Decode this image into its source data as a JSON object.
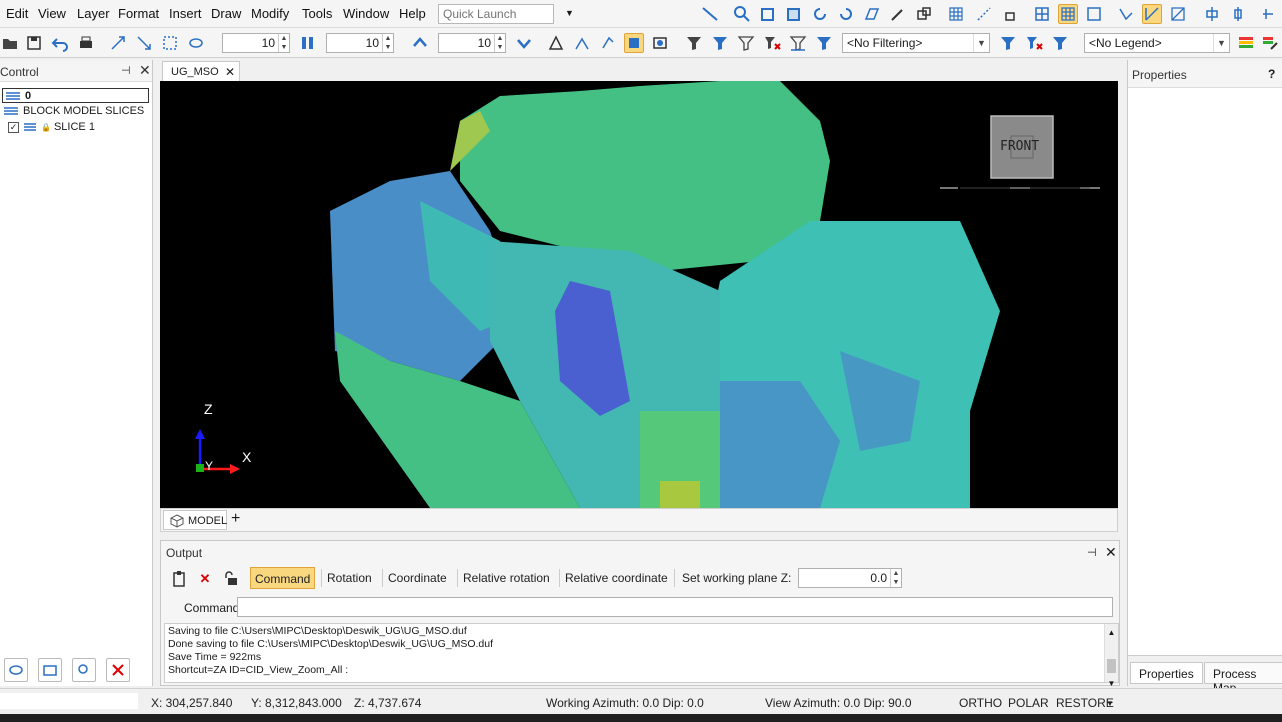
{
  "menu": {
    "items": [
      "Edit",
      "View",
      "Layer",
      "Format",
      "Insert",
      "Draw",
      "Modify",
      "Tools",
      "Window",
      "Help"
    ],
    "quick_launch_placeholder": "Quick Launch"
  },
  "toolbar": {
    "spin1": "10",
    "spin2": "10",
    "spin3": "10",
    "filter_value": "<No Filtering>",
    "legend_value": "<No Legend>"
  },
  "control": {
    "title": "Control",
    "layer_zero": "0",
    "block_model_slices": "BLOCK MODEL SLICES",
    "slice_1": "SLICE 1"
  },
  "document": {
    "tab": "UG_MSO",
    "view_cube_label": "FRONT",
    "axis_z": "Z",
    "axis_x": "X",
    "axis_y": "Y",
    "model_tab": "MODEL",
    "add_tab": "+"
  },
  "output": {
    "title": "Output",
    "tabs": {
      "command": "Command",
      "rotation": "Rotation",
      "coordinate": "Coordinate",
      "relative_rotation": "Relative rotation",
      "relative_coordinate": "Relative coordinate",
      "set_working_plane": "Set working plane Z:"
    },
    "working_plane_value": "0.0",
    "command_label": "Command:",
    "log": [
      "Saving to file C:\\Users\\MIPC\\Desktop\\Deswik_UG\\UG_MSO.duf",
      "Done saving to file C:\\Users\\MIPC\\Desktop\\Deswik_UG\\UG_MSO.duf",
      "Save Time = 922ms",
      "Shortcut=ZA ID=CID_View_Zoom_All :"
    ]
  },
  "properties": {
    "title": "Properties",
    "help": "?",
    "tab_properties": "Properties",
    "tab_process_map": "Process Map"
  },
  "status": {
    "x": "X: 304,257.840",
    "y": "Y: 8,312,843.000",
    "z": "Z: 4,737.674",
    "working_azimuth": "Working Azimuth: 0.0 Dip: 0.0",
    "view_azimuth": "View Azimuth: 0.0 Dip: 90.0",
    "ortho": "ORTHO",
    "polar": "POLAR",
    "restore": "RESTORE"
  },
  "colors": {
    "accent": "#f9d77e",
    "viewport_bg": "#000000",
    "model_green": "#3fbf7f",
    "model_teal": "#3dbcb4",
    "model_blue": "#4a86c8",
    "model_indigo": "#4a5fd0"
  }
}
